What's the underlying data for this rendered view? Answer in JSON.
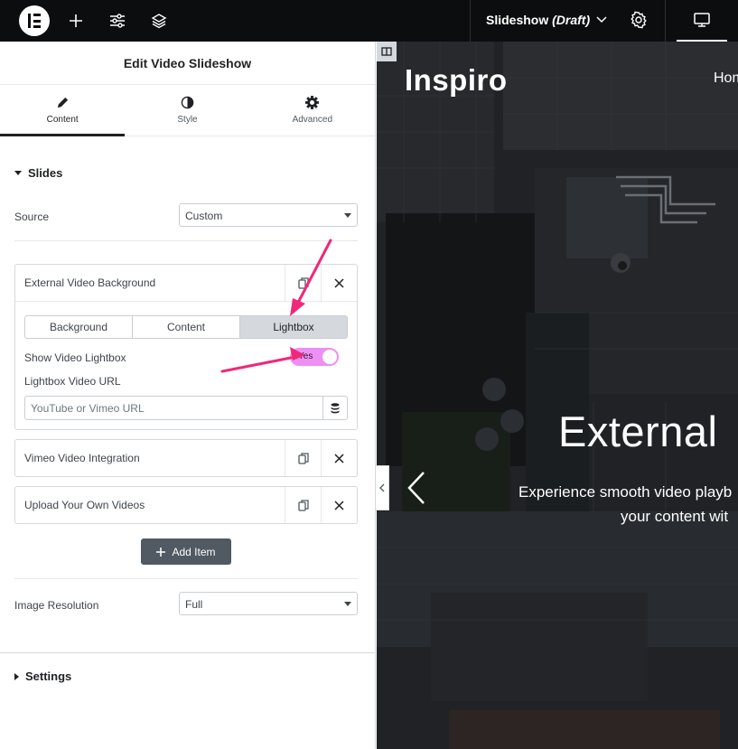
{
  "topbar": {
    "document_title": "Slideshow",
    "document_status": "(Draft)",
    "icons": [
      "elementor-logo-icon",
      "plus-icon",
      "sliders-icon",
      "layers-icon",
      "chevron-down-icon",
      "gear-icon",
      "desktop-icon"
    ]
  },
  "panel": {
    "title": "Edit Video Slideshow",
    "tabs": [
      {
        "label": "Content",
        "icon": "pencil-icon",
        "active": true
      },
      {
        "label": "Style",
        "icon": "half-circle-icon",
        "active": false
      },
      {
        "label": "Advanced",
        "icon": "gear-icon",
        "active": false
      }
    ],
    "slides_section": "Slides",
    "source_label": "Source",
    "source_value": "Custom",
    "items": [
      {
        "title": "External Video Background",
        "expanded": true,
        "subtabs": [
          "Background",
          "Content",
          "Lightbox"
        ],
        "active_subtab": "Lightbox",
        "show_lightbox_label": "Show Video Lightbox",
        "toggle_value": "Yes",
        "url_label": "Lightbox Video URL",
        "url_placeholder": "YouTube or Vimeo URL"
      },
      {
        "title": "Vimeo Video Integration"
      },
      {
        "title": "Upload Your Own Videos"
      }
    ],
    "add_item_label": "Add Item",
    "image_resolution_label": "Image Resolution",
    "image_resolution_value": "Full",
    "settings_section": "Settings"
  },
  "preview": {
    "site_name": "Inspiro",
    "nav_item": "Hom",
    "hero_title": "External",
    "hero_line1": "Experience smooth video playb",
    "hero_line2": "your content wit"
  },
  "colors": {
    "topbar_bg": "#0c0d0e",
    "accent_arrow": "#f0287a",
    "toggle_on": "#ee8ff3",
    "button_dark": "#515962"
  }
}
